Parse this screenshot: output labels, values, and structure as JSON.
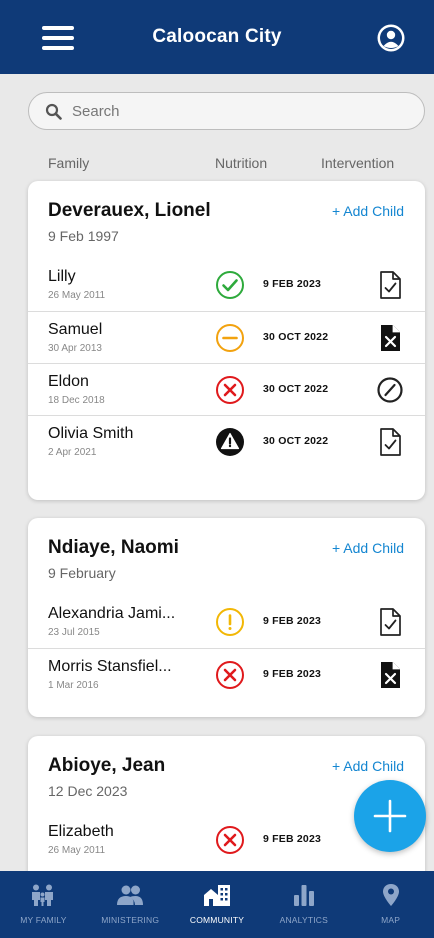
{
  "header": {
    "title": "Caloocan City"
  },
  "search": {
    "placeholder": "Search"
  },
  "columns": {
    "family": "Family",
    "nutrition": "Nutrition",
    "intervention": "Intervention"
  },
  "families": [
    {
      "name": "Deverauex, Lionel",
      "date": "9 Feb 1997",
      "add_child_label": "+ Add Child",
      "children": [
        {
          "name": "Lilly",
          "dob": "26 May 2011",
          "status": "check-circle-green",
          "date": "9 FEB 2023",
          "intervention": "document-check"
        },
        {
          "name": "Samuel",
          "dob": "30 Apr 2013",
          "status": "minus-circle-orange",
          "date": "30 OCT 2022",
          "intervention": "document-x"
        },
        {
          "name": "Eldon",
          "dob": "18 Dec 2018",
          "status": "x-circle-red",
          "date": "30 OCT 2022",
          "intervention": "slash-circle"
        },
        {
          "name": "Olivia Smith",
          "dob": "2 Apr 2021",
          "status": "warning-circle-black",
          "date": "30 OCT 2022",
          "intervention": "document-check"
        }
      ]
    },
    {
      "name": "Ndiaye, Naomi",
      "date": "9 February",
      "add_child_label": "+ Add Child",
      "children": [
        {
          "name": "Alexandria Jami...",
          "dob": "23 Jul 2015",
          "status": "exclamation-circle-yellow",
          "date": "9 FEB 2023",
          "intervention": "document-check"
        },
        {
          "name": "Morris Stansfiel...",
          "dob": "1 Mar 2016",
          "status": "x-circle-red",
          "date": "9 FEB 2023",
          "intervention": "document-x"
        }
      ]
    },
    {
      "name": "Abioye, Jean",
      "date": "12 Dec 2023",
      "add_child_label": "+ Add Child",
      "children": [
        {
          "name": "Elizabeth",
          "dob": "26 May 2011",
          "status": "x-circle-red",
          "date": "9 FEB 2023",
          "intervention": ""
        }
      ]
    }
  ],
  "nav": [
    {
      "label": "MY FAMILY",
      "icon": "family-icon",
      "active": false
    },
    {
      "label": "MINISTERING",
      "icon": "people-icon",
      "active": false
    },
    {
      "label": "COMMUNITY",
      "icon": "community-icon",
      "active": true
    },
    {
      "label": "ANALYTICS",
      "icon": "analytics-icon",
      "active": false
    },
    {
      "label": "MAP",
      "icon": "map-pin-icon",
      "active": false
    }
  ],
  "colors": {
    "header_bg": "#0f3a78",
    "accent": "#1486d1",
    "fab": "#1ba3e8",
    "ok_green": "#2eaa3c",
    "warn_orange": "#f2a20f",
    "alert_red": "#e0191c",
    "caution_yellow": "#f2b705"
  }
}
